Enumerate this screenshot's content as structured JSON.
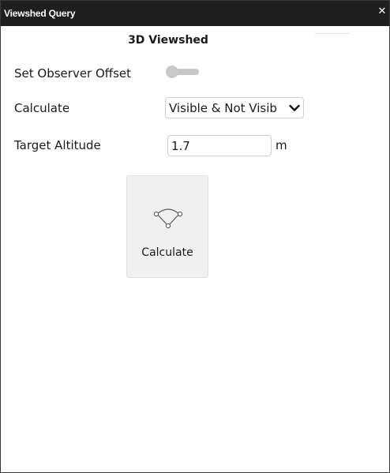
{
  "window": {
    "title": "Viewshed Query",
    "close_glyph": "✕"
  },
  "panel": {
    "title": "3D Viewshed"
  },
  "observer_offset": {
    "label": "Set Observer Offset",
    "enabled": false
  },
  "calculate_mode": {
    "label": "Calculate",
    "selected": "Visible & Not Visib",
    "icon": "chevron-down-icon"
  },
  "target_altitude": {
    "label": "Target Altitude",
    "value": "1.7",
    "unit": "m"
  },
  "calculate_button": {
    "label": "Calculate",
    "icon": "viewshed-cone-icon"
  },
  "colors": {
    "titlebar": "#1f1f1f",
    "tile_background": "#f0f0f0",
    "toggle_off": "#c8c8c8"
  }
}
